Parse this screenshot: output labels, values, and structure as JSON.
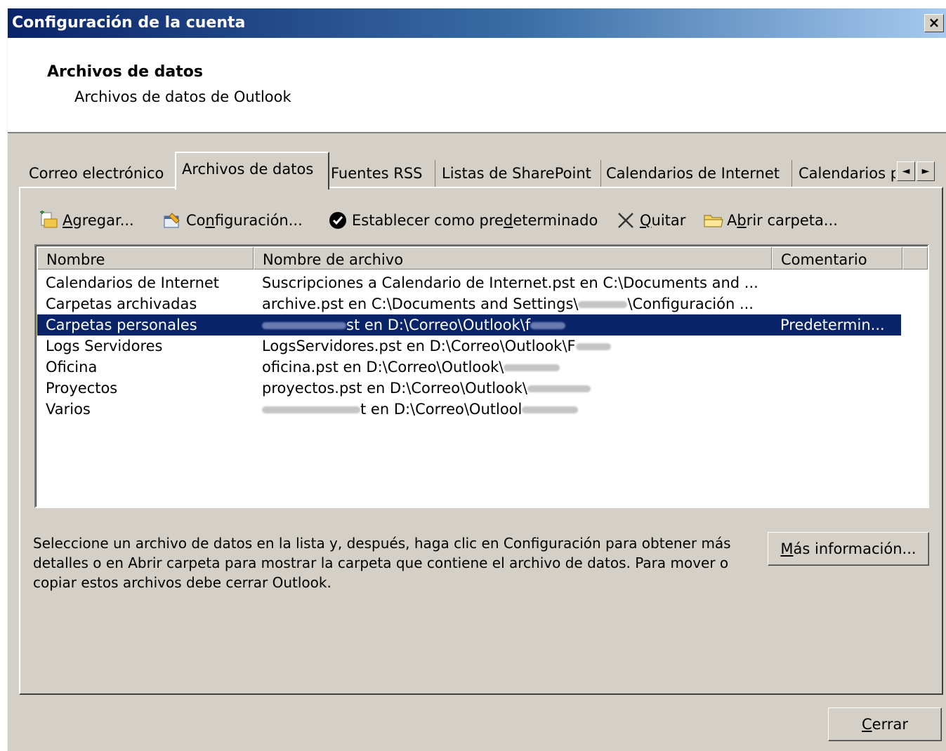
{
  "window": {
    "title": "Configuración de la cuenta",
    "close_label": "×"
  },
  "header": {
    "title": "Archivos de datos",
    "subtitle": "Archivos de datos de Outlook"
  },
  "tabs": [
    {
      "label": "Correo electrónico",
      "active": false
    },
    {
      "label": "Archivos de datos",
      "active": true
    },
    {
      "label": "Fuentes RSS",
      "active": false
    },
    {
      "label": "Listas de SharePoint",
      "active": false
    },
    {
      "label": "Calendarios de Internet",
      "active": false
    },
    {
      "label": "Calendarios p",
      "active": false
    }
  ],
  "tab_scroll": {
    "left": "◄",
    "right": "►"
  },
  "toolbar": {
    "add": {
      "pre": "",
      "key": "A",
      "post": "gregar...",
      "icon": "add-file-icon"
    },
    "settings": {
      "pre": "Co",
      "key": "n",
      "post": "figuración...",
      "icon": "settings-icon"
    },
    "set_default": {
      "pre": "Establecer como pre",
      "key": "d",
      "post": "eterminado",
      "icon": "checkmark-icon"
    },
    "remove": {
      "pre": "",
      "key": "Q",
      "post": "uitar",
      "icon": "x-icon"
    },
    "open_folder": {
      "pre": "A",
      "key": "b",
      "post": "rir carpeta...",
      "icon": "folder-icon"
    }
  },
  "table": {
    "columns": [
      "Nombre",
      "Nombre de archivo",
      "Comentario"
    ],
    "rows": [
      {
        "name": "Calendarios de Internet",
        "file": "Suscripciones a Calendario de Internet.pst en C:\\Documents and ...",
        "comment": "",
        "selected": false
      },
      {
        "name": "Carpetas archivadas",
        "file": "archive.pst en C:\\Documents and Settings\\",
        "file_tail": "\\Configuración ...",
        "comment": "",
        "selected": false
      },
      {
        "name": "Carpetas personales",
        "file": "st en D:\\Correo\\Outlook\\f",
        "comment": "Predetermin...",
        "selected": true
      },
      {
        "name": "Logs Servidores",
        "file": "LogsServidores.pst en D:\\Correo\\Outlook\\F",
        "comment": "",
        "selected": false
      },
      {
        "name": "Oficina",
        "file": "oficina.pst en D:\\Correo\\Outlook\\",
        "comment": "",
        "selected": false
      },
      {
        "name": "Proyectos",
        "file": "proyectos.pst en D:\\Correo\\Outlook\\",
        "comment": "",
        "selected": false
      },
      {
        "name": "Varios",
        "file": "t en D:\\Correo\\Outlool",
        "comment": "",
        "selected": false
      }
    ]
  },
  "description": "Seleccione un archivo de datos en la lista y, después, haga clic en Configuración para obtener más detalles o en Abrir carpeta para mostrar la carpeta que contiene el archivo de datos. Para mover o copiar estos archivos debe cerrar Outlook.",
  "more_info": {
    "key": "M",
    "post": "ás información..."
  },
  "close_button": {
    "key": "C",
    "post": "errar"
  }
}
